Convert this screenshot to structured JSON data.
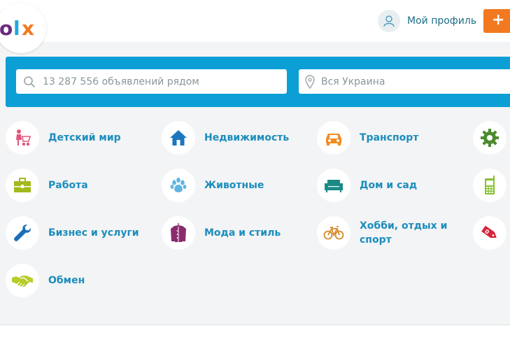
{
  "header": {
    "logo_text": "OLX",
    "profile_label": "Мой профиль",
    "add_button_icon": "+"
  },
  "search": {
    "placeholder": "13 287 556 объявлений рядом",
    "location_placeholder": "Вся Украина"
  },
  "categories": [
    {
      "label": "Детский мир",
      "icon": "stroller-icon",
      "color": "#e0577c"
    },
    {
      "label": "Недвижимость",
      "icon": "house-icon",
      "color": "#1c77bd"
    },
    {
      "label": "Транспорт",
      "icon": "car-icon",
      "color": "#f28b20"
    },
    {
      "label": "",
      "icon": "gear-icon",
      "color": "#4e8a2e"
    },
    {
      "label": "Работа",
      "icon": "briefcase-icon",
      "color": "#a3b91c"
    },
    {
      "label": "Животные",
      "icon": "paw-icon",
      "color": "#5fb5e0"
    },
    {
      "label": "Дом и сад",
      "icon": "sofa-icon",
      "color": "#1a8a86"
    },
    {
      "label": "",
      "icon": "phone-icon",
      "color": "#85c12f"
    },
    {
      "label": "Бизнес и услуги",
      "icon": "wrench-icon",
      "color": "#1c6fb8"
    },
    {
      "label": "Мода и стиль",
      "icon": "coat-icon",
      "color": "#8a2b6e"
    },
    {
      "label": "Хобби, отдых и спорт",
      "icon": "bicycle-icon",
      "color": "#d68a2a"
    },
    {
      "label": "",
      "icon": "price-tag-icon",
      "color": "#d6243a"
    },
    {
      "label": "Обмен",
      "icon": "handshake-icon",
      "color": "#b5cc2a"
    }
  ]
}
